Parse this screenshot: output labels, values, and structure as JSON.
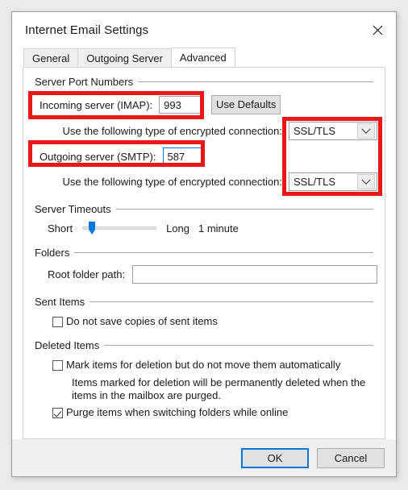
{
  "window": {
    "title": "Internet Email Settings",
    "close_icon": "close-icon"
  },
  "tabs": [
    {
      "label": "General",
      "active": false
    },
    {
      "label": "Outgoing Server",
      "active": false
    },
    {
      "label": "Advanced",
      "active": true
    }
  ],
  "server_port_numbers": {
    "group_title": "Server Port Numbers",
    "incoming_label": "Incoming server (IMAP):",
    "incoming_value": "993",
    "use_defaults_label": "Use Defaults",
    "incoming_encryption_label": "Use the following type of encrypted connection:",
    "incoming_encryption_value": "SSL/TLS",
    "outgoing_label": "Outgoing server (SMTP):",
    "outgoing_value": "587",
    "outgoing_encryption_label": "Use the following type of encrypted connection:",
    "outgoing_encryption_value": "SSL/TLS"
  },
  "server_timeouts": {
    "group_title": "Server Timeouts",
    "short_label": "Short",
    "long_label": "Long",
    "value_label": "1 minute",
    "slider_percent": 9
  },
  "folders": {
    "group_title": "Folders",
    "root_folder_label": "Root folder path:",
    "root_folder_value": "",
    "root_folder_placeholder": ""
  },
  "sent_items": {
    "group_title": "Sent Items",
    "do_not_save_label": "Do not save copies of sent items",
    "do_not_save_checked": false
  },
  "deleted_items": {
    "group_title": "Deleted Items",
    "mark_items_label": "Mark items for deletion but do not move them automatically",
    "mark_items_checked": false,
    "note_line1": "Items marked for deletion will be permanently deleted when the",
    "note_line2": "items in the mailbox are purged.",
    "purge_label": "Purge items when switching folders while online",
    "purge_checked": true
  },
  "footer": {
    "ok_label": "OK",
    "cancel_label": "Cancel"
  },
  "annotations": {
    "highlight_color": "#e81818",
    "boxes": [
      {
        "name": "incoming-server-highlight"
      },
      {
        "name": "outgoing-server-highlight"
      },
      {
        "name": "encryption-dropdowns-highlight"
      }
    ]
  }
}
